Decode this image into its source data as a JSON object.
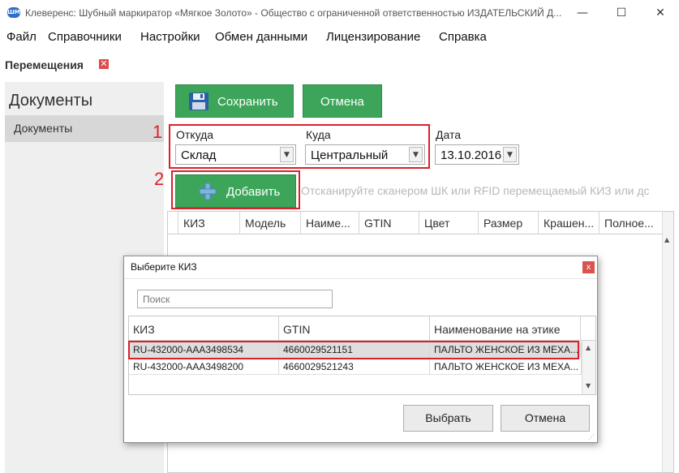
{
  "window": {
    "title": "Клеверенс: Шубный маркиратор «Мягкое Золото» - Общество с ограниченной ответственностью ИЗДАТЕЛЬСКИЙ Д...",
    "icon_text": "ШМ",
    "minimize": "—",
    "maximize": "☐",
    "close": "✕"
  },
  "menu": [
    "Файл",
    "Справочники",
    "Настройки",
    "Обмен данными",
    "Лицензирование",
    "Справка"
  ],
  "page": {
    "title": "Перемещения",
    "close_glyph": "✕"
  },
  "sidebar": {
    "title": "Документы",
    "items": [
      {
        "label": "Документы"
      }
    ]
  },
  "toolbar": {
    "save_label": "Сохранить",
    "cancel_label": "Отмена",
    "add_label": "Добавить"
  },
  "callouts": {
    "one": "1",
    "two": "2"
  },
  "form": {
    "from": {
      "label": "Откуда",
      "value": "Склад"
    },
    "to": {
      "label": "Куда",
      "value": "Центральный"
    },
    "date": {
      "label": "Дата",
      "value": "13.10.2016"
    }
  },
  "hint": "Отсканируйте сканером ШК или RFID перемещаемый КИЗ или дс",
  "grid": {
    "columns": [
      "КИЗ",
      "Модель",
      "Наиме...",
      "GTIN",
      "Цвет",
      "Размер",
      "Крашен...",
      "Полное..."
    ]
  },
  "dialog": {
    "title": "Выберите КИЗ",
    "close_glyph": "x",
    "search_placeholder": "Поиск",
    "columns": [
      "КИЗ",
      "GTIN",
      "Наименование на этике"
    ],
    "rows": [
      {
        "kiz": "RU-432000-AAA3498534",
        "gtin": "4660029521151",
        "name": "ПАЛЬТО ЖЕНСКОЕ ИЗ МЕХА...",
        "selected": true
      },
      {
        "kiz": "RU-432000-AAA3498200",
        "gtin": "4660029521243",
        "name": "ПАЛЬТО ЖЕНСКОЕ ИЗ МЕХА...",
        "selected": false
      }
    ],
    "select_label": "Выбрать",
    "cancel_label": "Отмена"
  },
  "colors": {
    "accent_green": "#3da55a",
    "highlight_red": "#d9212a",
    "sidebar_bg": "#efefef"
  }
}
